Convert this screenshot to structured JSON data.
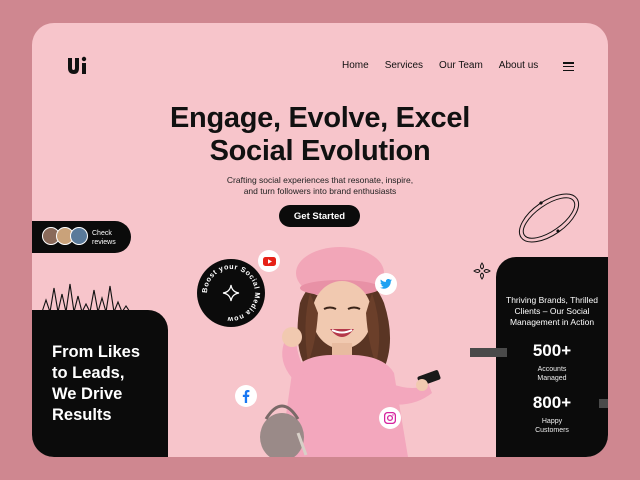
{
  "nav": {
    "items": [
      "Home",
      "Services",
      "Our Team",
      "About us"
    ]
  },
  "hero": {
    "title_line1": "Engage, Evolve, Excel",
    "title_line2": "Social Evolution",
    "subtitle_line1": "Crafting social experiences that resonate, inspire,",
    "subtitle_line2": "and turn followers into brand enthusiasts",
    "cta_label": "Get Started"
  },
  "reviews": {
    "label_line1": "Check",
    "label_line2": "reviews"
  },
  "badge_text": "Boost your Social Media now",
  "left_panel": {
    "line1": "From Likes",
    "line2": "to Leads,",
    "line3": "We Drive",
    "line4": "Results"
  },
  "right_panel": {
    "heading_line1": "Thriving Brands, Thrilled",
    "heading_line2": "Clients – Our Social",
    "heading_line3": "Management in Action",
    "stats": [
      {
        "value": "500+",
        "label_line1": "Accounts",
        "label_line2": "Managed"
      },
      {
        "value": "800+",
        "label_line1": "Happy",
        "label_line2": "Customers"
      }
    ]
  },
  "social_icons": [
    "youtube-icon",
    "twitter-icon",
    "facebook-icon",
    "instagram-icon"
  ],
  "colors": {
    "background": "#cf8790",
    "card": "#f7c5cb",
    "dark": "#0b0b0b",
    "youtube": "#e62117",
    "twitter": "#1da1f2",
    "facebook": "#1877f2",
    "instagram": "#d6249f"
  }
}
